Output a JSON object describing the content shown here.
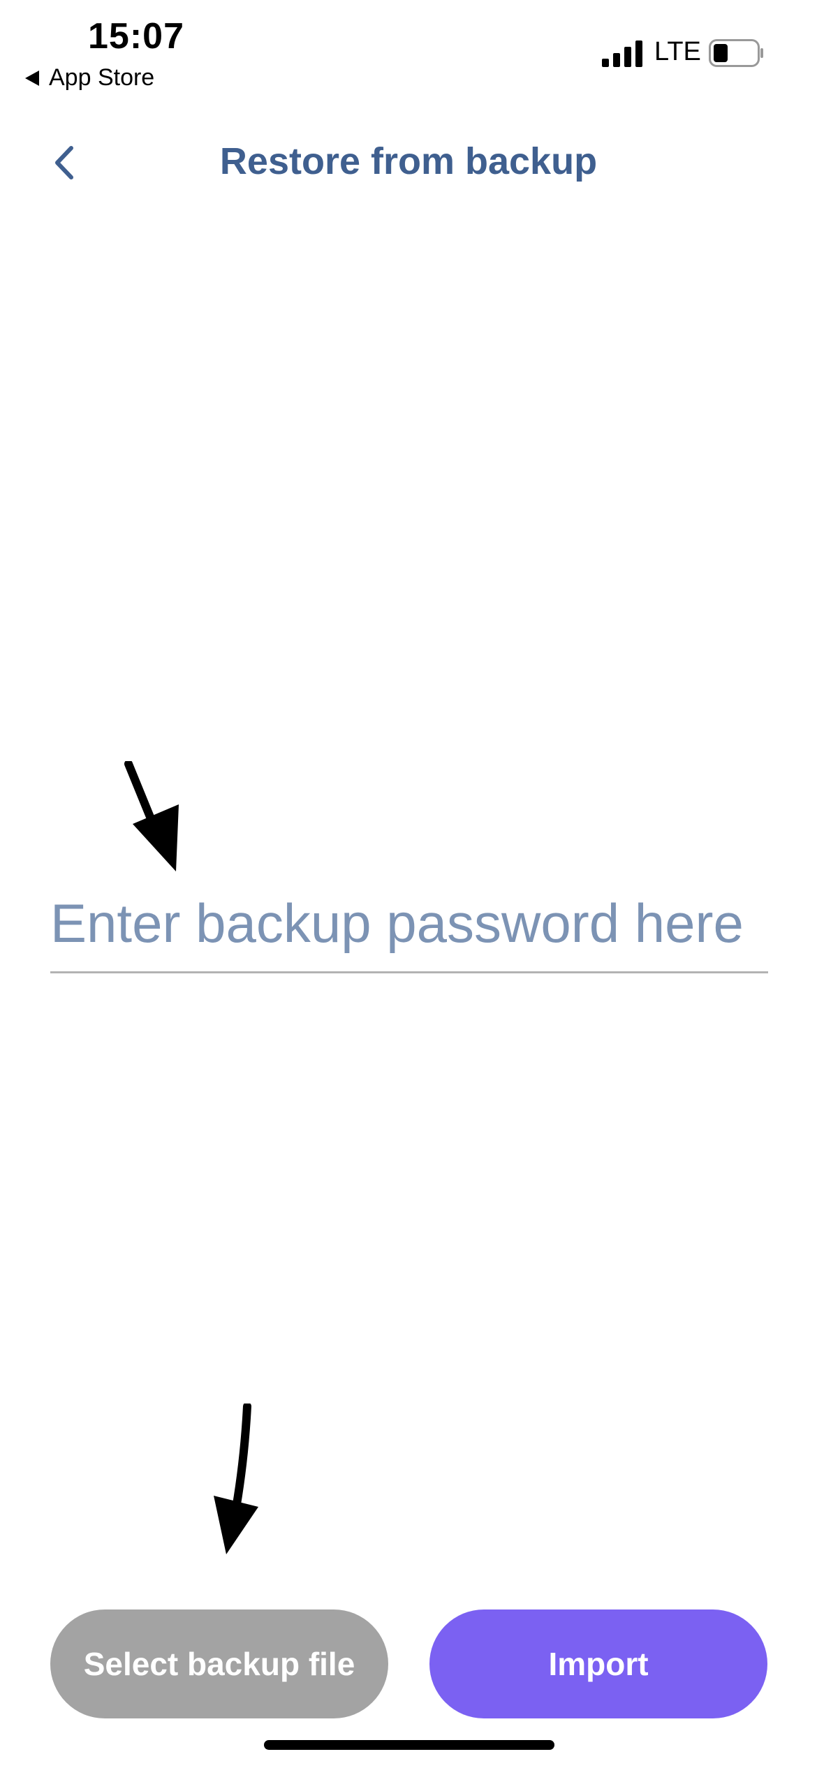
{
  "status_bar": {
    "time": "15:07",
    "back_app": "App Store",
    "network": "LTE",
    "signal_icon": "cellular-signal-icon",
    "battery_icon": "battery-low-icon"
  },
  "header": {
    "title": "Restore from backup",
    "back_icon": "chevron-left-icon"
  },
  "form": {
    "password_placeholder": "Enter backup password here",
    "password_value": ""
  },
  "buttons": {
    "select_file": "Select backup file",
    "import": "Import"
  },
  "colors": {
    "title": "#3f5f8f",
    "placeholder": "#7c93b4",
    "select_button": "#a3a3a3",
    "import_button": "#7b61f2"
  }
}
